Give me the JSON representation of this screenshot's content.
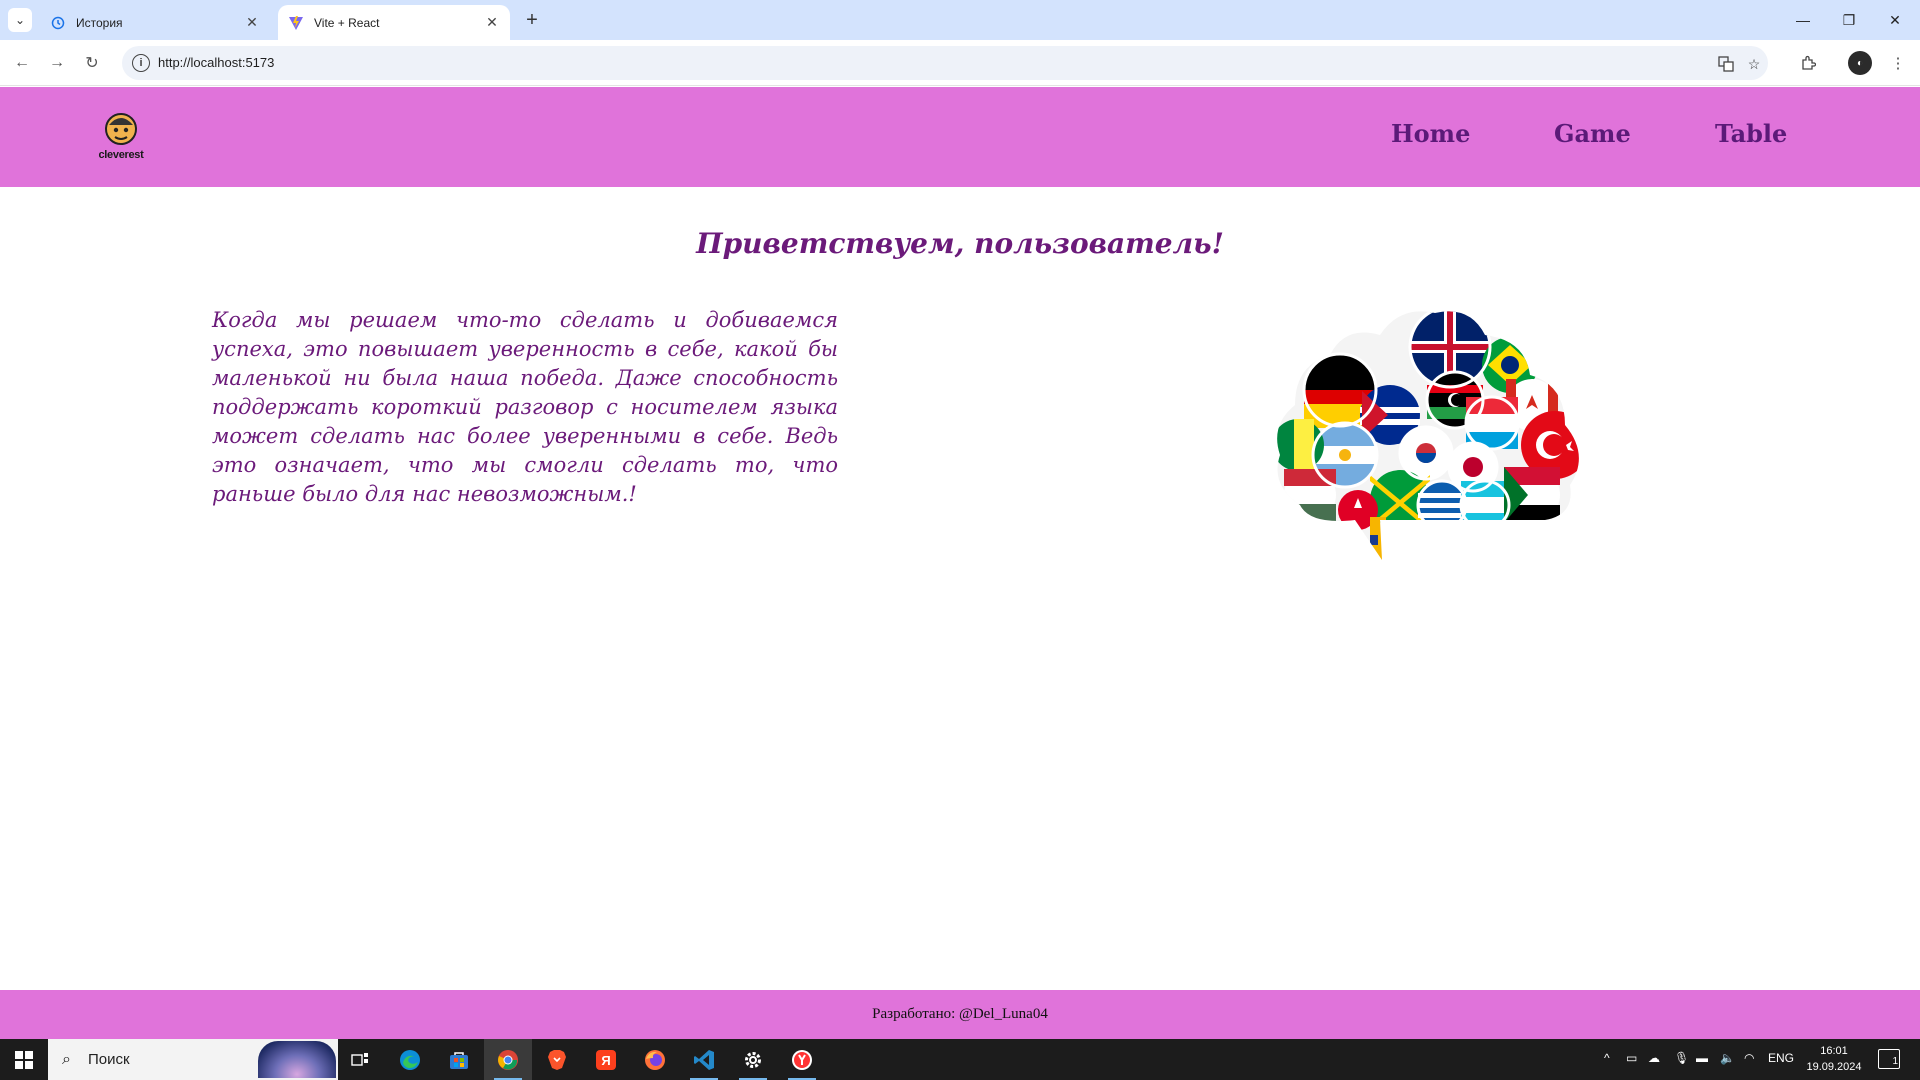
{
  "browser": {
    "tabs": [
      {
        "title": "История",
        "icon": "history-icon",
        "active": false
      },
      {
        "title": "Vite + React",
        "icon": "vite-icon",
        "active": true
      }
    ],
    "url": "http://localhost:5173"
  },
  "site": {
    "logo_text": "cleverest",
    "nav": [
      "Home",
      "Game",
      "Table"
    ],
    "heading": "Приветствуем, пользователь!",
    "paragraph": "Когда мы решаем что-то сделать и добиваемся успеха, это повышает уверенность в себе, какой бы маленькой ни была наша победа. Даже способность поддержать короткий разговор с носителем языка может сделать нас более уверенными в себе. Ведь это означает, что мы смогли сделать то, что раньше было для нас невозможным.!",
    "footer": "Разработано: @Del_Luna04",
    "image": "flags-speech-cloud",
    "colors": {
      "header_bg": "#e073da",
      "text": "#6b1a7a",
      "nav": "#5b1a78"
    }
  },
  "taskbar": {
    "search_placeholder": "Поиск",
    "apps": [
      "task-view",
      "edge",
      "store",
      "chrome",
      "brave",
      "yandex",
      "firefox",
      "vscode",
      "settings",
      "yandex-browser"
    ],
    "language": "ENG",
    "time": "16:01",
    "date": "19.09.2024",
    "notifications": "1"
  }
}
